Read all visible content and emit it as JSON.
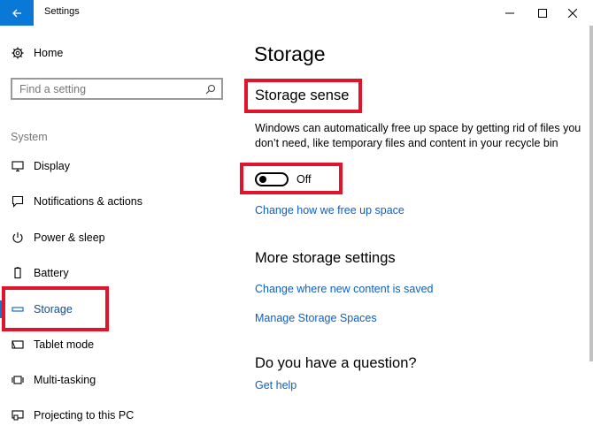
{
  "window": {
    "title": "Settings",
    "accent_color": "#0a78d7",
    "highlight_color": "#e0142b"
  },
  "sidebar": {
    "home_label": "Home",
    "search_placeholder": "Find a setting",
    "section_header": "System",
    "items": [
      {
        "label": "Display",
        "icon": "display-icon"
      },
      {
        "label": "Notifications & actions",
        "icon": "notifications-icon"
      },
      {
        "label": "Power & sleep",
        "icon": "power-icon"
      },
      {
        "label": "Battery",
        "icon": "battery-icon"
      },
      {
        "label": "Storage",
        "icon": "storage-icon",
        "active": true
      },
      {
        "label": "Tablet mode",
        "icon": "tablet-mode-icon"
      },
      {
        "label": "Multi-tasking",
        "icon": "multitasking-icon"
      },
      {
        "label": "Projecting to this PC",
        "icon": "projecting-icon"
      }
    ]
  },
  "main": {
    "title": "Storage",
    "storage_sense": {
      "heading": "Storage sense",
      "description": "Windows can automatically free up space by getting rid of files you don’t need, like temporary files and content in your recycle bin",
      "toggle_state": "Off",
      "link": "Change how we free up space"
    },
    "more_settings": {
      "heading": "More storage settings",
      "links": [
        "Change where new content is saved",
        "Manage Storage Spaces"
      ]
    },
    "question": {
      "heading": "Do you have a question?",
      "link": "Get help"
    }
  }
}
